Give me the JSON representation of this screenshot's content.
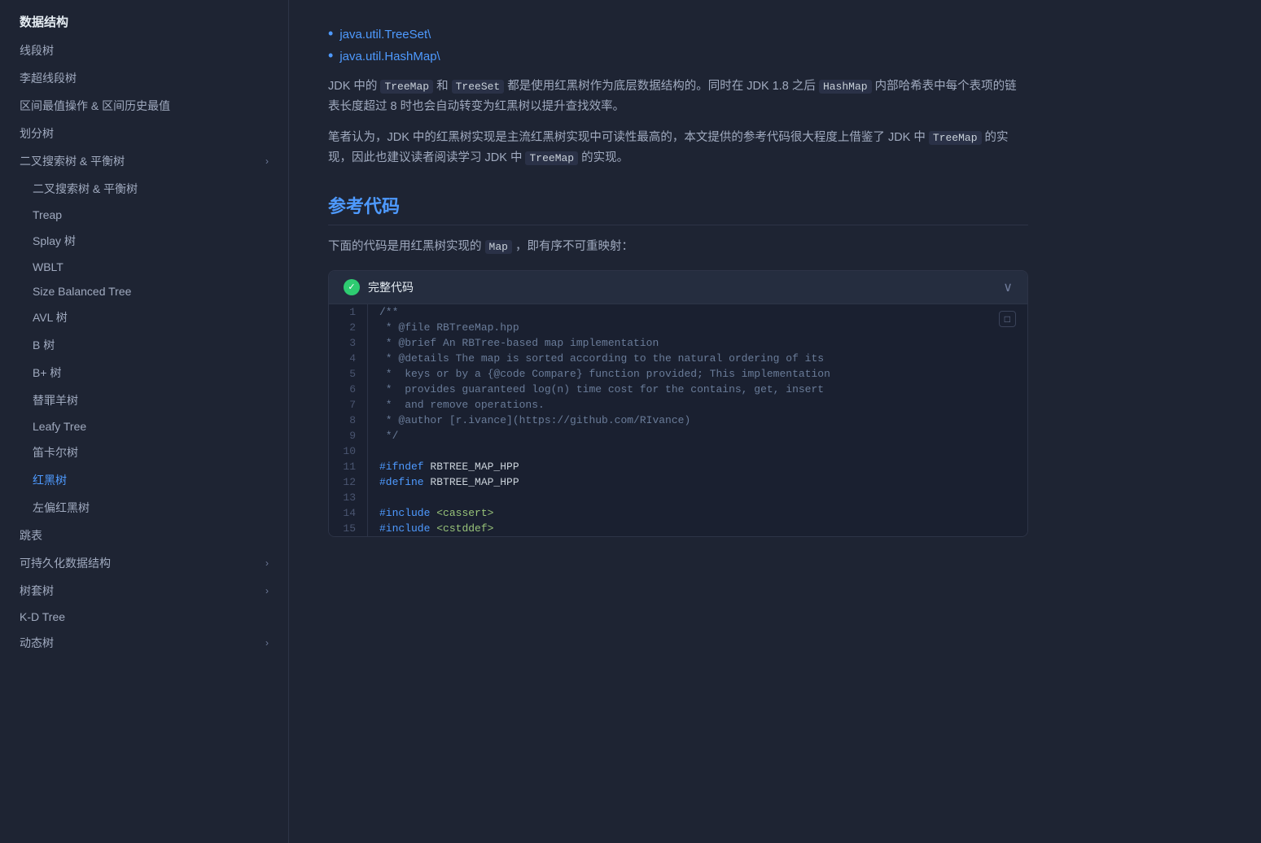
{
  "sidebar": {
    "section_title": "数据结构",
    "items": [
      {
        "id": "segment-tree",
        "label": "线段树",
        "indent": false,
        "active": false
      },
      {
        "id": "lichao-tree",
        "label": "李超线段树",
        "indent": false,
        "active": false
      },
      {
        "id": "range-ops",
        "label": "区间最值操作 & 区间历史最值",
        "indent": false,
        "active": false
      },
      {
        "id": "divide-tree",
        "label": "划分树",
        "indent": false,
        "active": false
      },
      {
        "id": "bst-balanced",
        "label": "二叉搜索树 & 平衡树",
        "indent": false,
        "active": false,
        "arrow": "›"
      },
      {
        "id": "bst-balanced-sub",
        "label": "二叉搜索树 & 平衡树",
        "indent": true,
        "active": false
      },
      {
        "id": "treap",
        "label": "Treap",
        "indent": true,
        "active": false
      },
      {
        "id": "splay",
        "label": "Splay 树",
        "indent": true,
        "active": false
      },
      {
        "id": "wblt",
        "label": "WBLT",
        "indent": true,
        "active": false
      },
      {
        "id": "size-balanced-tree",
        "label": "Size Balanced Tree",
        "indent": true,
        "active": false
      },
      {
        "id": "avl",
        "label": "AVL 树",
        "indent": true,
        "active": false
      },
      {
        "id": "b-tree",
        "label": "B 树",
        "indent": true,
        "active": false
      },
      {
        "id": "bplus-tree",
        "label": "B+ 树",
        "indent": true,
        "active": false
      },
      {
        "id": "scapegoat",
        "label": "替罪羊树",
        "indent": true,
        "active": false
      },
      {
        "id": "leafy-tree",
        "label": "Leafy Tree",
        "indent": true,
        "active": false
      },
      {
        "id": "cartesian-tree",
        "label": "笛卡尔树",
        "indent": true,
        "active": false
      },
      {
        "id": "rb-tree",
        "label": "红黑树",
        "indent": true,
        "active": true
      },
      {
        "id": "left-rb-tree",
        "label": "左偏红黑树",
        "indent": true,
        "active": false
      },
      {
        "id": "skip-list",
        "label": "跳表",
        "indent": false,
        "active": false
      },
      {
        "id": "persistent",
        "label": "可持久化数据结构",
        "indent": false,
        "active": false,
        "arrow": "›"
      },
      {
        "id": "tree-set",
        "label": "树套树",
        "indent": false,
        "active": false,
        "arrow": "›"
      },
      {
        "id": "kd-tree",
        "label": "K-D Tree",
        "indent": false,
        "active": false
      },
      {
        "id": "dynamic-tree",
        "label": "动态树",
        "indent": false,
        "active": false,
        "arrow": "›"
      }
    ]
  },
  "main": {
    "bullets": [
      {
        "text": "java.util.TreeSet\\"
      },
      {
        "text": "java.util.HashMap\\"
      }
    ],
    "para1": "JDK 中的 TreeMap 和 TreeSet 都是使用红黑树作为底层数据结构的。同时在 JDK 1.8 之后 HashMap 内部哈希表中每个表项的链表长度超过 8 时也会自动转变为红黑树以提升查找效率。",
    "para2": "笔者认为，JDK 中的红黑树实现是主流红黑树实现中可读性最高的，本文提供的参考代码很大程度上借鉴了 JDK 中 TreeMap 的实现，因此也建议读者阅读学习 JDK 中 TreeMap 的实现。",
    "section_heading": "参考代码",
    "para3_prefix": "下面的代码是用红黑树实现的",
    "para3_code": "Map",
    "para3_suffix": "，即有序不可重映射：",
    "code_block": {
      "title": "完整代码",
      "copy_label": "□",
      "chevron": "∨",
      "lines": [
        {
          "num": 1,
          "code": "/**",
          "type": "comment"
        },
        {
          "num": 2,
          "code": " * @file RBTreeMap.hpp",
          "type": "comment"
        },
        {
          "num": 3,
          "code": " * @brief An RBTree-based map implementation",
          "type": "comment"
        },
        {
          "num": 4,
          "code": " * @details The map is sorted according to the natural ordering of its",
          "type": "comment"
        },
        {
          "num": 5,
          "code": " *  keys or by a {@code Compare} function provided; This implementation",
          "type": "comment"
        },
        {
          "num": 6,
          "code": " *  provides guaranteed log(n) time cost for the contains, get, insert",
          "type": "comment"
        },
        {
          "num": 7,
          "code": " *  and remove operations.",
          "type": "comment"
        },
        {
          "num": 8,
          "code": " * @author [r.ivance](https://github.com/RIvance)",
          "type": "comment"
        },
        {
          "num": 9,
          "code": " */",
          "type": "comment"
        },
        {
          "num": 10,
          "code": "",
          "type": "blank"
        },
        {
          "num": 11,
          "code": "#ifndef RBTREE_MAP_HPP",
          "type": "keyword_blue"
        },
        {
          "num": 12,
          "code": "#define RBTREE_MAP_HPP",
          "type": "keyword_blue"
        },
        {
          "num": 13,
          "code": "",
          "type": "blank"
        },
        {
          "num": 14,
          "code": "#include <cassert>",
          "type": "keyword_include"
        },
        {
          "num": 15,
          "code": "#include <cstddef>",
          "type": "keyword_include"
        }
      ]
    }
  },
  "icons": {
    "check": "✓",
    "copy": "□",
    "chevron_down": "∨",
    "arrow_right": "›"
  }
}
